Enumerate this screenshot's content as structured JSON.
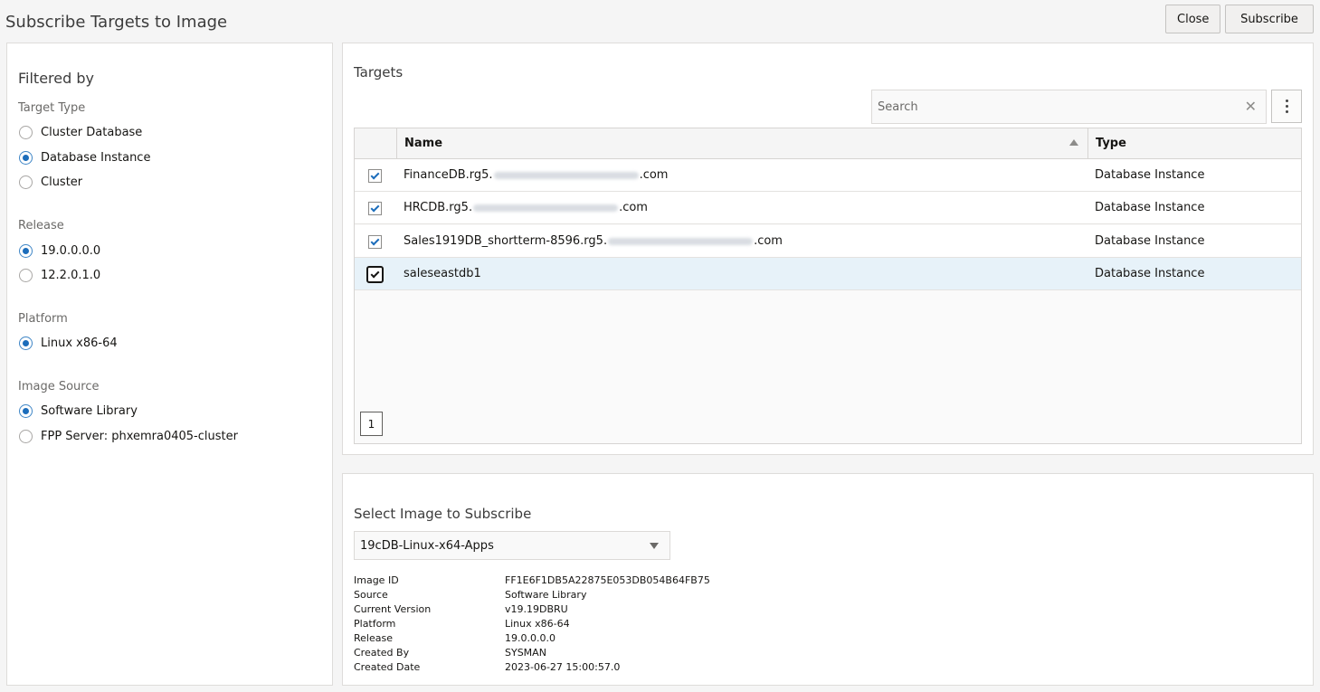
{
  "header": {
    "title": "Subscribe Targets to Image",
    "close_label": "Close",
    "subscribe_label": "Subscribe"
  },
  "filters": {
    "heading": "Filtered by",
    "target_type": {
      "label": "Target Type",
      "options": [
        {
          "label": "Cluster Database",
          "checked": false
        },
        {
          "label": "Database Instance",
          "checked": true
        },
        {
          "label": "Cluster",
          "checked": false
        }
      ]
    },
    "release": {
      "label": "Release",
      "options": [
        {
          "label": "19.0.0.0.0",
          "checked": true
        },
        {
          "label": "12.2.0.1.0",
          "checked": false
        }
      ]
    },
    "platform": {
      "label": "Platform",
      "options": [
        {
          "label": "Linux x86-64",
          "checked": true
        }
      ]
    },
    "image_source": {
      "label": "Image Source",
      "options": [
        {
          "label": "Software Library",
          "checked": true
        },
        {
          "label": "FPP Server: phxemra0405-cluster",
          "checked": false
        }
      ]
    }
  },
  "targets": {
    "title": "Targets",
    "search_placeholder": "Search",
    "columns": {
      "name": "Name",
      "type": "Type"
    },
    "rows": [
      {
        "name_prefix": "FinanceDB.rg5.",
        "name_suffix": ".com",
        "type": "Database Instance",
        "checked": true
      },
      {
        "name_prefix": "HRCDB.rg5.",
        "name_suffix": ".com",
        "type": "Database Instance",
        "checked": true
      },
      {
        "name_prefix": "Sales1919DB_shortterm-8596.rg5.",
        "name_suffix": ".com",
        "type": "Database Instance",
        "checked": true
      },
      {
        "name_prefix": "saleseastdb1",
        "name_suffix": "",
        "type": "Database Instance",
        "checked": true
      }
    ],
    "page": "1"
  },
  "image": {
    "title": "Select Image to Subscribe",
    "selected": "19cDB-Linux-x64-Apps",
    "details": [
      {
        "label": "Image ID",
        "value": "FF1E6F1DB5A22875E053DB054B64FB75"
      },
      {
        "label": "Source",
        "value": "Software Library"
      },
      {
        "label": "Current Version",
        "value": "v19.19DBRU"
      },
      {
        "label": "Platform",
        "value": "Linux x86-64"
      },
      {
        "label": "Release",
        "value": "19.0.0.0.0"
      },
      {
        "label": "Created By",
        "value": "SYSMAN"
      },
      {
        "label": "Created Date",
        "value": "2023-06-27 15:00:57.0"
      }
    ]
  },
  "colors": {
    "accent": "#1c6dbb",
    "selected_row": "#e7f2f9"
  }
}
